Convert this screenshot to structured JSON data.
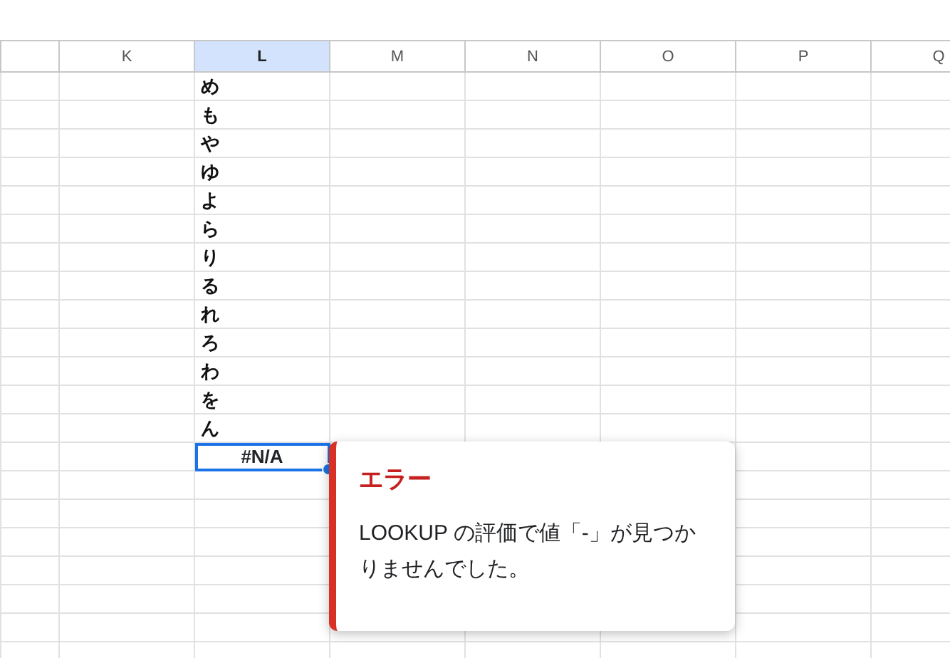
{
  "table": {
    "columns": [
      {
        "label": "K",
        "selected": false
      },
      {
        "label": "L",
        "selected": true
      },
      {
        "label": "M",
        "selected": false
      },
      {
        "label": "N",
        "selected": false
      },
      {
        "label": "O",
        "selected": false
      },
      {
        "label": "P",
        "selected": false
      },
      {
        "label": "Q",
        "selected": false
      }
    ],
    "column_L_cells": [
      {
        "text": "め",
        "selected": false
      },
      {
        "text": "も",
        "selected": false
      },
      {
        "text": "や",
        "selected": false
      },
      {
        "text": "ゆ",
        "selected": false
      },
      {
        "text": "よ",
        "selected": false
      },
      {
        "text": "ら",
        "selected": false
      },
      {
        "text": "り",
        "selected": false
      },
      {
        "text": "る",
        "selected": false
      },
      {
        "text": "れ",
        "selected": false
      },
      {
        "text": "ろ",
        "selected": false
      },
      {
        "text": "わ",
        "selected": false
      },
      {
        "text": "を",
        "selected": false
      },
      {
        "text": "ん",
        "selected": false
      },
      {
        "text": "#N/A",
        "selected": true,
        "kind": "error"
      }
    ]
  },
  "error_popup": {
    "title": "エラー",
    "message": "LOOKUP の評価で値「-」が見つかりませんでした。"
  }
}
